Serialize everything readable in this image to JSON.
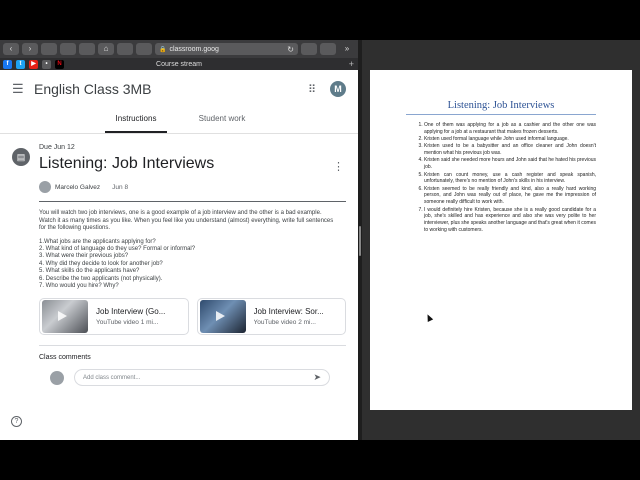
{
  "browser": {
    "url": "classroom.goog",
    "tab_title": "Course stream",
    "toolbar": {
      "back_glyph": "‹",
      "forward_glyph": "›",
      "home_glyph": "⌂",
      "reload_glyph": "↻",
      "overflow_glyph": "»"
    },
    "bookmarks": [
      {
        "name": "facebook",
        "glyph": "f",
        "color": "#1877f2"
      },
      {
        "name": "twitter",
        "glyph": "t",
        "color": "#1da1f2"
      },
      {
        "name": "youtube",
        "glyph": "▶",
        "color": "#e62117"
      },
      {
        "name": "bookmark-4",
        "glyph": "•",
        "color": "#5a5a5c"
      },
      {
        "name": "netflix",
        "glyph": "N",
        "color": "#e50914"
      }
    ],
    "new_tab_glyph": "+"
  },
  "classroom": {
    "course_title": "English Class 3MB",
    "avatar_initial": "M",
    "tabs": [
      "Instructions",
      "Student work"
    ],
    "assignment": {
      "due": "Due Jun 12",
      "title": "Listening: Job Interviews",
      "author": "Marcelo Galvez",
      "posted": "Jun 8",
      "description": "You will watch two job interviews, one is a good example of a job interview and the other is a bad example. Watch it as many times as you like. When you feel like you understand (almost) everything, write full sentences for the following questions.",
      "questions": [
        "1.What jobs are the applicants applying for?",
        "2. What kind of language do they use? Formal or informal?",
        "3. What were their previous jobs?",
        "4. Why did they decide to look for another job?",
        "5. What skills do the applicants have?",
        "6. Describe the two applicants (not physically).",
        "7. Who would you hire? Why?"
      ],
      "videos": [
        {
          "title": "Job Interview (Go...",
          "type": "YouTube video",
          "duration": "1 mi..."
        },
        {
          "title": "Job Interview: Sor...",
          "type": "YouTube video",
          "duration": "2 mi..."
        }
      ]
    },
    "comments_label": "Class comments",
    "comment_placeholder": "Add class comment..."
  },
  "document": {
    "title": "Listening: Job Interviews",
    "answers": [
      "One of them was applying for a job as a cashier and the other one was applying for a job at a restaurant that makes frozen desserts.",
      "Kristen used formal language while John used informal language.",
      "Kristen used to be a babysitter and an office cleaner and John doesn't mention what his previous job was.",
      "Kristen said she needed more hours and John said that he hated his previous job.",
      "Kristen can count money, use a cash register and speak spanish, unfortunately, there's no mention of John's skills in his interview.",
      "Kristen seemed to be really friendly and kind, also a really hard working person, and John was really out of place, he gave me the impression of someone really difficult to work with.",
      "I would definitely hire Kristen, because she is a really good candidate for a job, she's skilled and has experience and also she was very polite to her interviewer, plus she speaks another language and that's great when it comes to working with customers."
    ]
  },
  "colors": {
    "doc_title": "#2e5395",
    "chrome_bg": "#3b3b3d",
    "active_tab_underline": "#202124"
  }
}
